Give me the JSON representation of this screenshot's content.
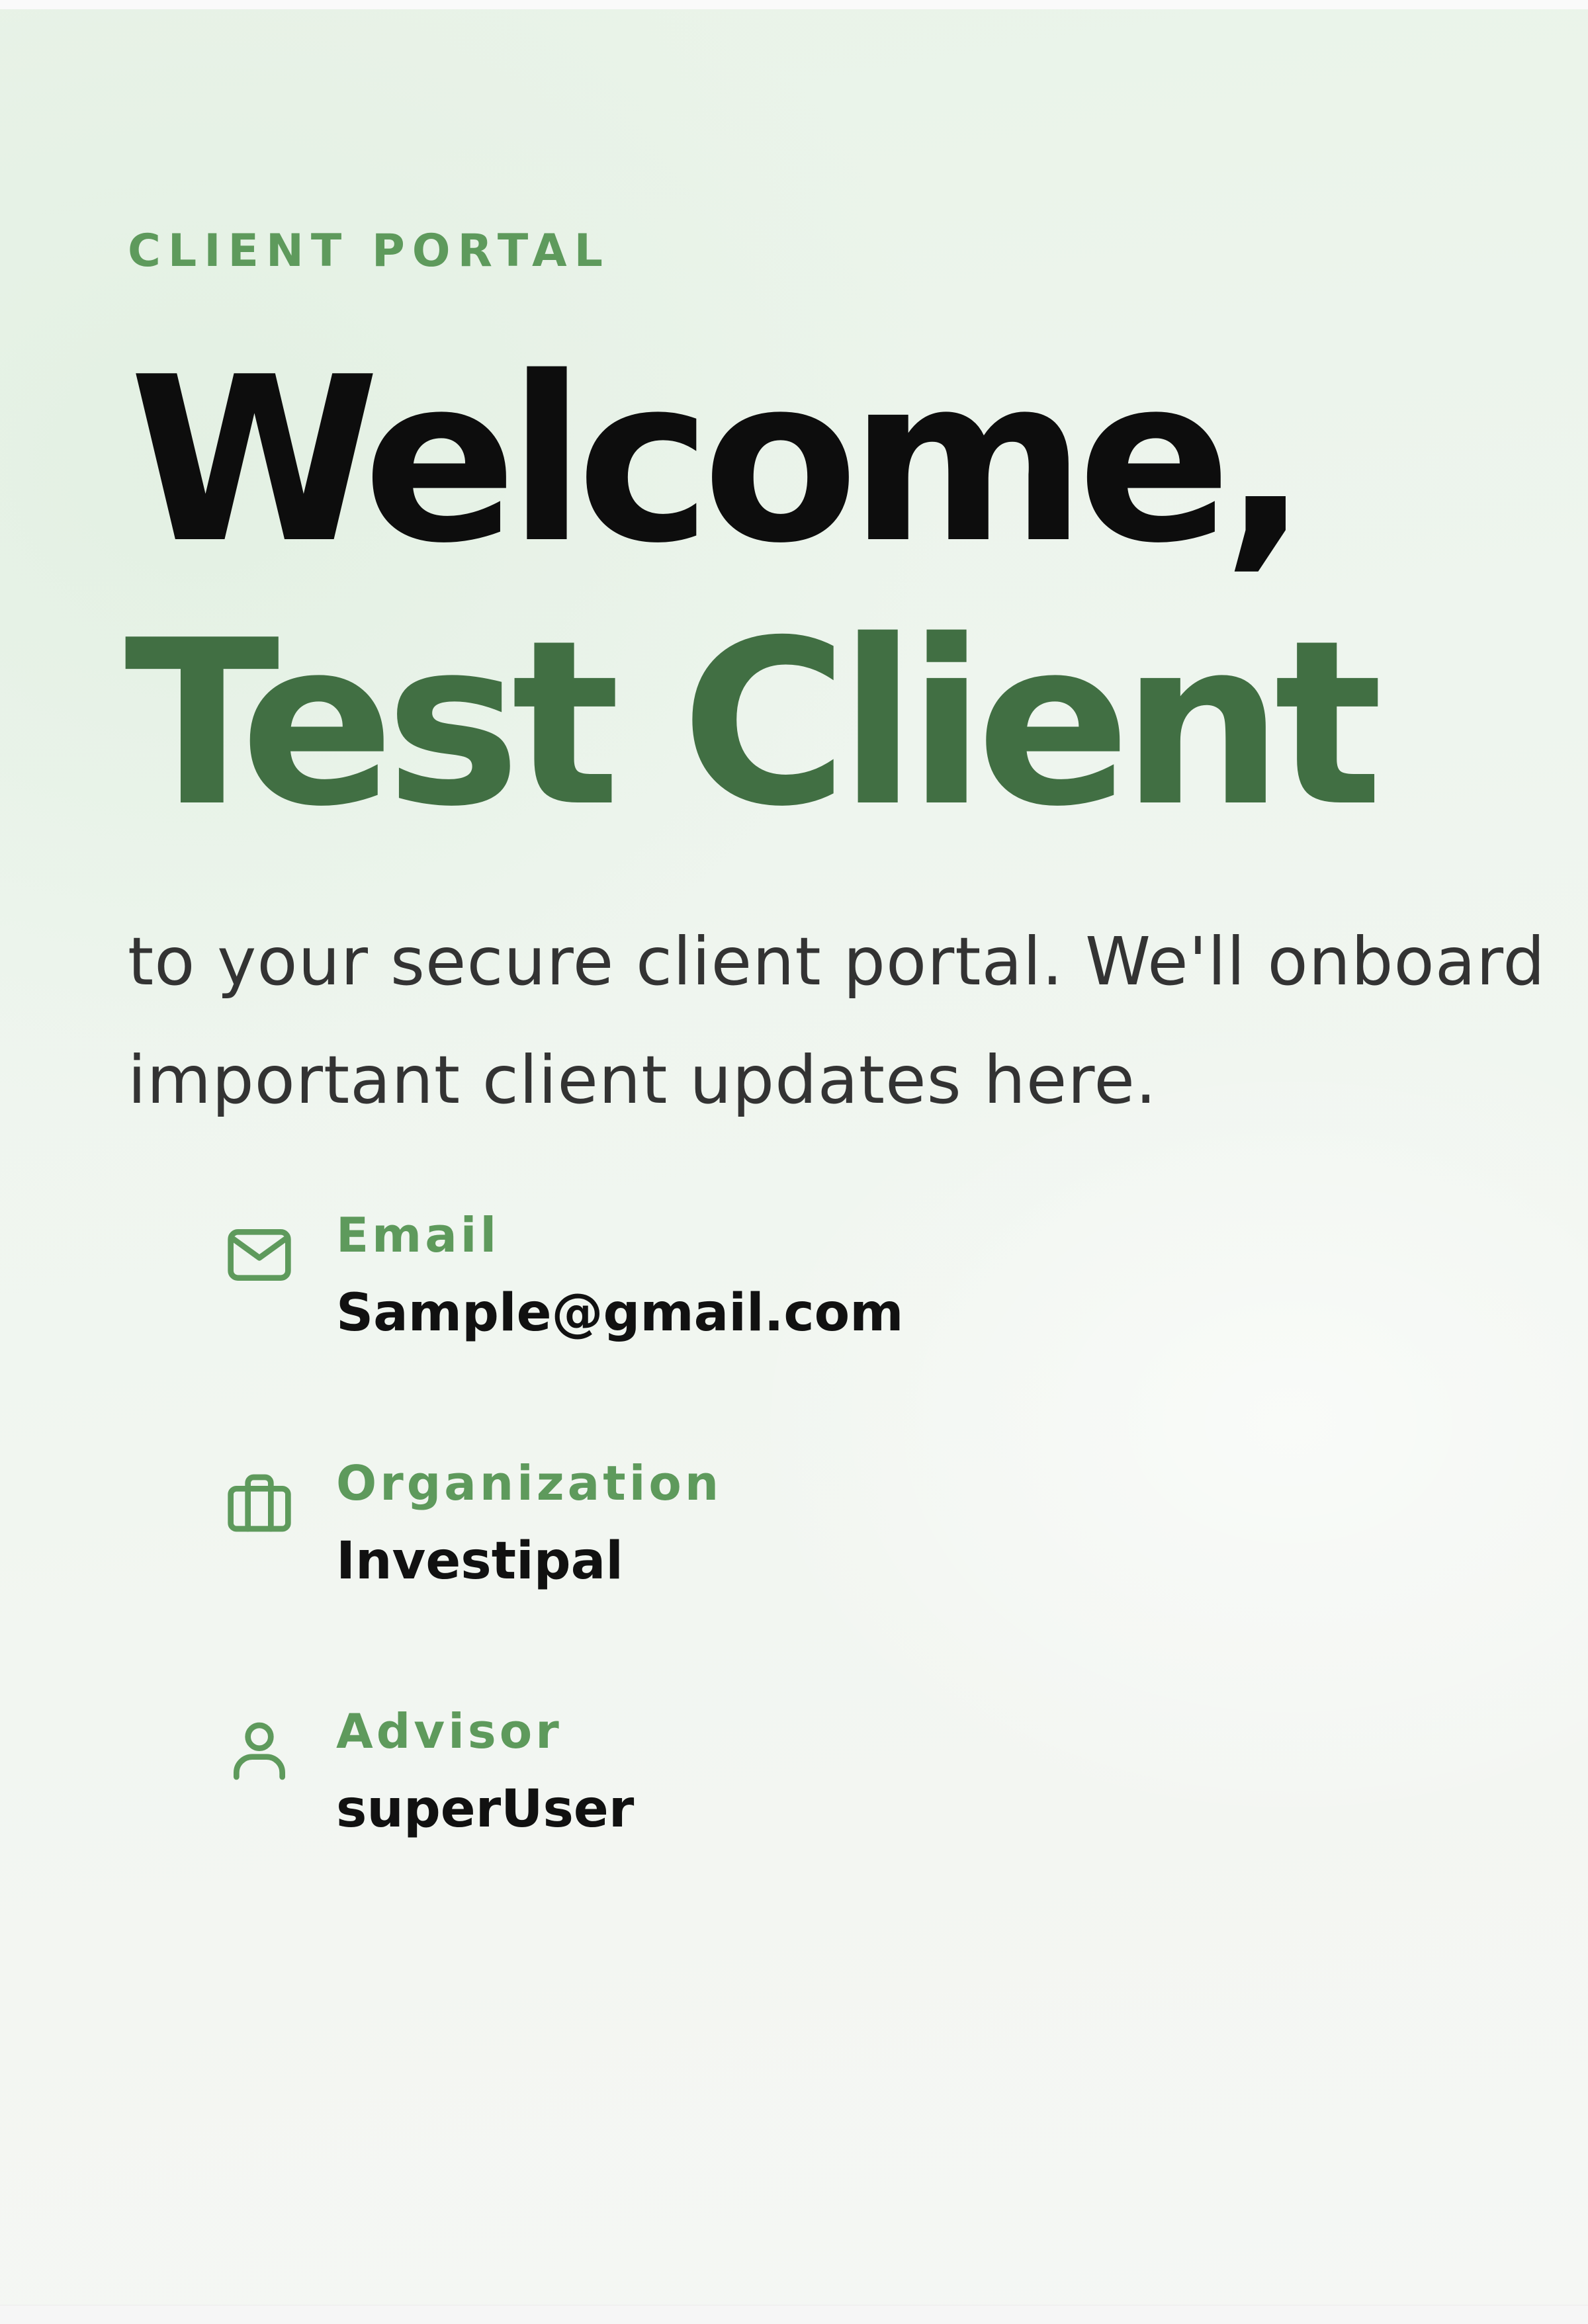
{
  "header": {
    "eyebrow": "CLIENT PORTAL",
    "greeting": "Welcome,",
    "client_name": "Test Client"
  },
  "intro": {
    "line1": "to your secure client portal. We'll onboard",
    "line2": "important client updates here."
  },
  "details": [
    {
      "icon": "mail-icon",
      "label": "Email",
      "value": "Sample@gmail.com"
    },
    {
      "icon": "briefcase-icon",
      "label": "Organization",
      "value": "Investipal"
    },
    {
      "icon": "user-icon",
      "label": "Advisor",
      "value": "superUser"
    }
  ],
  "colors": {
    "accent_green": "#5e9a5c",
    "name_green": "#416f43",
    "heading_black": "#0d0d0d",
    "body_text": "#333333",
    "background": "#eef5ee"
  }
}
